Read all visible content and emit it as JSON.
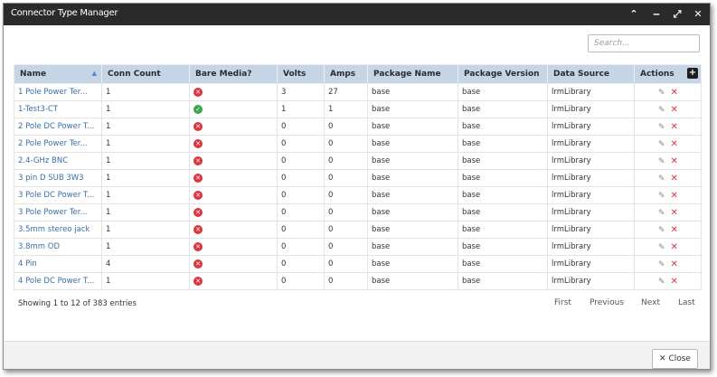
{
  "window": {
    "title": "Connector Type Manager",
    "controls": [
      "collapse-icon",
      "minimize-icon",
      "maximize-icon",
      "close-icon"
    ]
  },
  "search": {
    "placeholder": "Search..."
  },
  "table": {
    "columns": [
      "Name",
      "Conn Count",
      "Bare Media?",
      "Volts",
      "Amps",
      "Package Name",
      "Package Version",
      "Data Source",
      "Actions"
    ],
    "rows": [
      {
        "name": "1 Pole Power Ter...",
        "conn": "1",
        "bare": "no",
        "volts": "3",
        "amps": "27",
        "pkg": "base",
        "ver": "base",
        "src": "lrmLibrary"
      },
      {
        "name": "1-Test3-CT",
        "conn": "1",
        "bare": "yes",
        "volts": "1",
        "amps": "1",
        "pkg": "base",
        "ver": "base",
        "src": "lrmLibrary"
      },
      {
        "name": "2 Pole DC Power T...",
        "conn": "1",
        "bare": "no",
        "volts": "0",
        "amps": "0",
        "pkg": "base",
        "ver": "base",
        "src": "lrmLibrary"
      },
      {
        "name": "2 Pole Power Ter...",
        "conn": "1",
        "bare": "no",
        "volts": "0",
        "amps": "0",
        "pkg": "base",
        "ver": "base",
        "src": "lrmLibrary"
      },
      {
        "name": "2.4-GHz BNC",
        "conn": "1",
        "bare": "no",
        "volts": "0",
        "amps": "0",
        "pkg": "base",
        "ver": "base",
        "src": "lrmLibrary"
      },
      {
        "name": "3 pin D SUB 3W3",
        "conn": "1",
        "bare": "no",
        "volts": "0",
        "amps": "0",
        "pkg": "base",
        "ver": "base",
        "src": "lrmLibrary"
      },
      {
        "name": "3 Pole DC Power T...",
        "conn": "1",
        "bare": "no",
        "volts": "0",
        "amps": "0",
        "pkg": "base",
        "ver": "base",
        "src": "lrmLibrary"
      },
      {
        "name": "3 Pole Power Ter...",
        "conn": "1",
        "bare": "no",
        "volts": "0",
        "amps": "0",
        "pkg": "base",
        "ver": "base",
        "src": "lrmLibrary"
      },
      {
        "name": "3.5mm stereo jack",
        "conn": "1",
        "bare": "no",
        "volts": "0",
        "amps": "0",
        "pkg": "base",
        "ver": "base",
        "src": "lrmLibrary"
      },
      {
        "name": "3.8mm OD",
        "conn": "1",
        "bare": "no",
        "volts": "0",
        "amps": "0",
        "pkg": "base",
        "ver": "base",
        "src": "lrmLibrary"
      },
      {
        "name": "4 Pin",
        "conn": "4",
        "bare": "no",
        "volts": "0",
        "amps": "0",
        "pkg": "base",
        "ver": "base",
        "src": "lrmLibrary"
      },
      {
        "name": "4 Pole DC Power T...",
        "conn": "1",
        "bare": "no",
        "volts": "0",
        "amps": "0",
        "pkg": "base",
        "ver": "base",
        "src": "lrmLibrary"
      }
    ]
  },
  "paging": {
    "info": "Showing 1 to 12 of 383 entries",
    "first": "First",
    "previous": "Previous",
    "next": "Next",
    "last": "Last"
  },
  "footer": {
    "close_label": "Close"
  }
}
